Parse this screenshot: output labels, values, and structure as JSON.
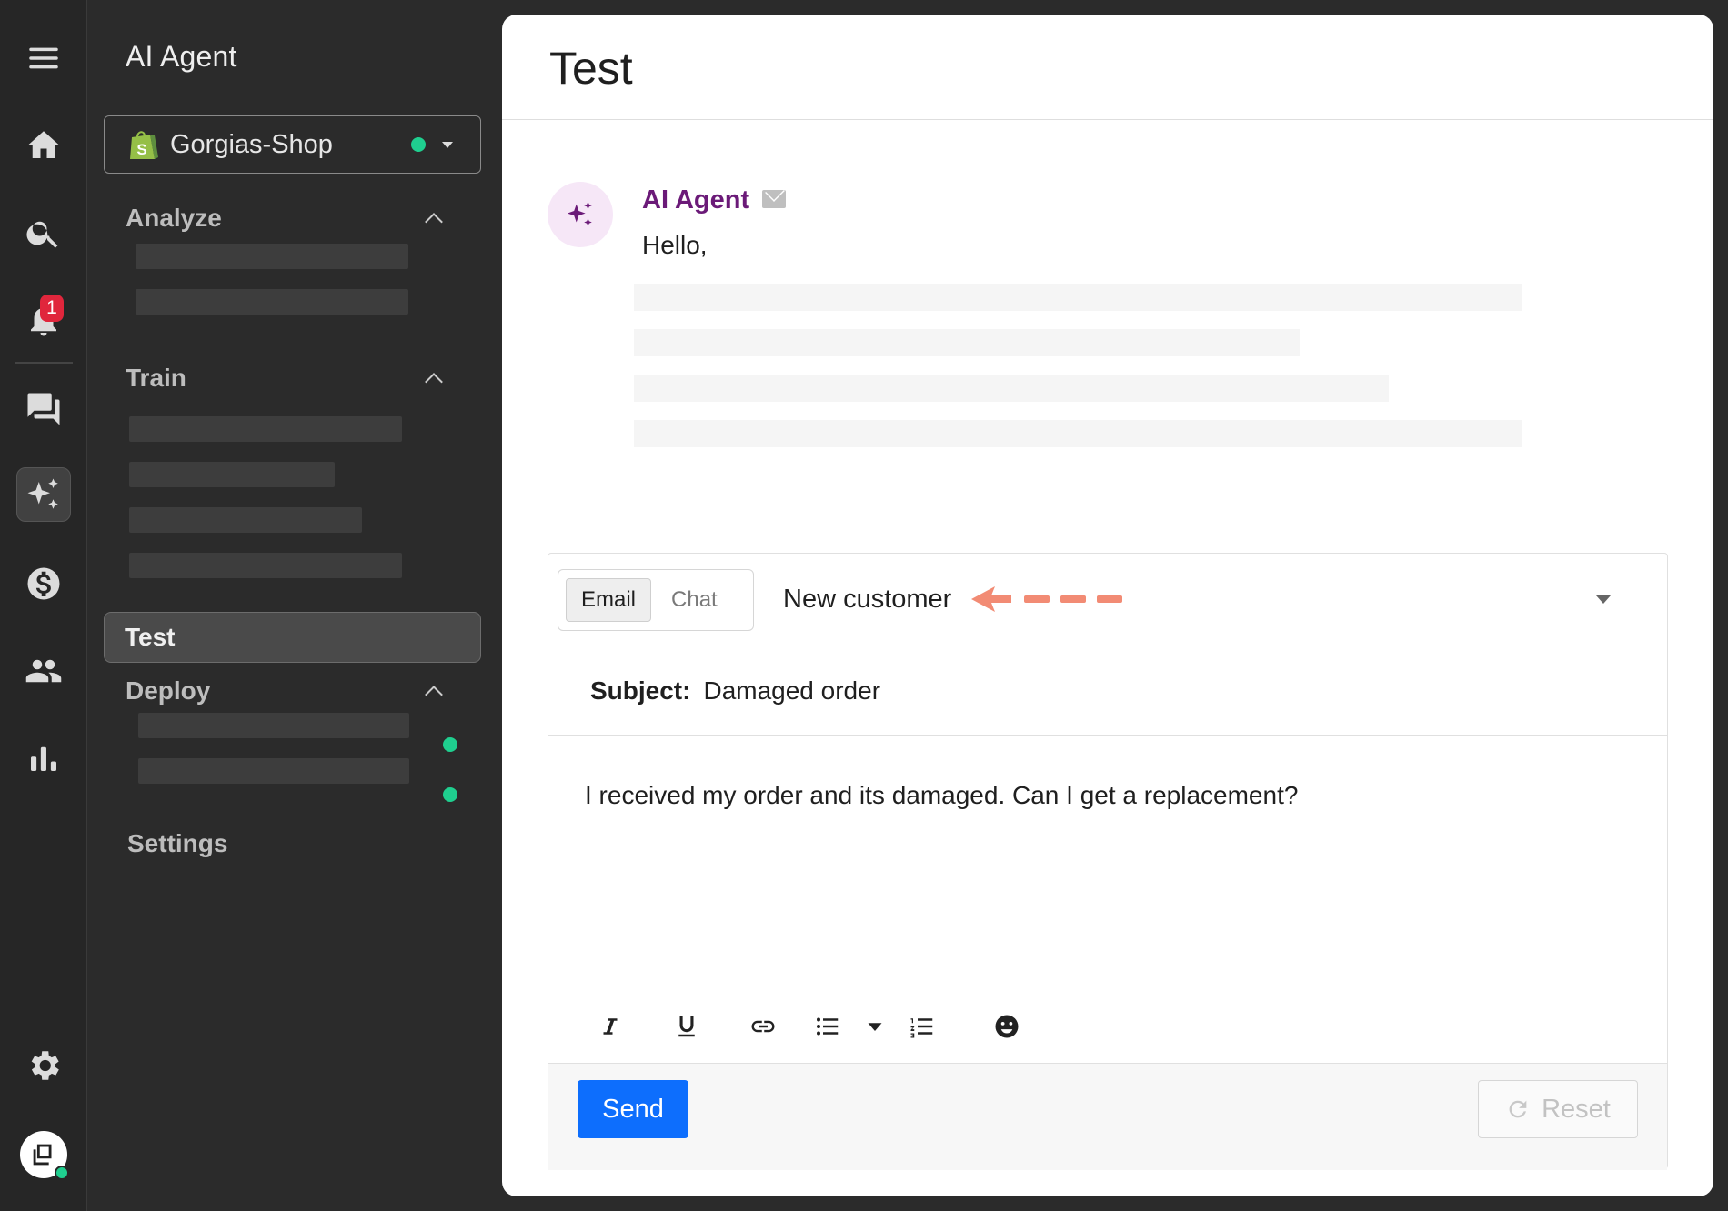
{
  "rail": {
    "notification_count": "1",
    "icons": [
      "menu-icon",
      "home-icon",
      "search-icon",
      "bell-icon",
      "chat-icon",
      "sparkle-icon",
      "dollar-icon",
      "users-icon",
      "bar-chart-icon",
      "gear-icon"
    ]
  },
  "sidebar": {
    "title": "AI Agent",
    "store": {
      "name": "Gorgias-Shop",
      "status_color": "#1fcf8f"
    },
    "sections": {
      "analyze": "Analyze",
      "train": "Train",
      "test": "Test",
      "deploy": "Deploy",
      "settings": "Settings"
    }
  },
  "main": {
    "title": "Test",
    "message": {
      "author": "AI Agent",
      "channel_icon": "mail-icon",
      "greeting": "Hello,"
    },
    "composer": {
      "tabs": [
        {
          "label": "Email",
          "active": true
        },
        {
          "label": "Chat",
          "active": false
        }
      ],
      "customer": "New customer",
      "subject_label": "Subject:",
      "subject_value": "Damaged order",
      "body": "I received my order and its damaged. Can I get a replacement?",
      "toolbar": [
        "italic-icon",
        "underline-icon",
        "link-icon",
        "bullet-list-icon",
        "list-dropdown-icon",
        "numbered-list-icon",
        "emoji-icon"
      ],
      "send_label": "Send",
      "reset_label": "Reset"
    }
  },
  "colors": {
    "accent": "#0d6efd",
    "agent_name": "#6b1a78",
    "status_green": "#1fcf8f",
    "badge_red": "#e0263c",
    "annotation_arrow": "#f28b74"
  }
}
